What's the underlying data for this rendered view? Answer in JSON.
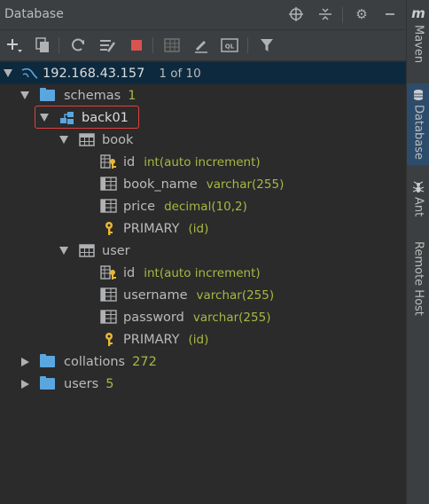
{
  "titlebar": {
    "title": "Database"
  },
  "toolbar": {
    "icons": [
      "add-icon",
      "copy-icon",
      "refresh-icon",
      "schema-sync-icon",
      "stop-icon",
      "table-icon",
      "edit-icon",
      "query-console-icon",
      "filter-icon"
    ],
    "stop_color": "#d9534f"
  },
  "tree": {
    "connection": {
      "host": "192.168.43.157",
      "count": "1 of 10"
    },
    "schemas": {
      "label": "schemas",
      "count": "1"
    },
    "schema": {
      "name": "back01"
    },
    "tables": [
      {
        "name": "book",
        "columns": [
          {
            "name": "id",
            "type": "int(auto increment)"
          },
          {
            "name": "book_name",
            "type": "varchar(255)"
          },
          {
            "name": "price",
            "type": "decimal(10,2)"
          }
        ],
        "key": {
          "name": "PRIMARY",
          "cols": "(id)"
        }
      },
      {
        "name": "user",
        "columns": [
          {
            "name": "id",
            "type": "int(auto increment)"
          },
          {
            "name": "username",
            "type": "varchar(255)"
          },
          {
            "name": "password",
            "type": "varchar(255)"
          }
        ],
        "key": {
          "name": "PRIMARY",
          "cols": "(id)"
        }
      }
    ],
    "collations": {
      "label": "collations",
      "count": "272"
    },
    "users": {
      "label": "users",
      "count": "5"
    }
  },
  "sidebar": {
    "tabs": [
      {
        "label": "Maven"
      },
      {
        "label": "Database"
      },
      {
        "label": "Ant"
      },
      {
        "label": "Remote Host"
      }
    ]
  },
  "colors": {
    "accent_text": "#a9b741",
    "folder": "#5aa7e0",
    "selection": "#0d293e",
    "highlight": "#e04040"
  }
}
